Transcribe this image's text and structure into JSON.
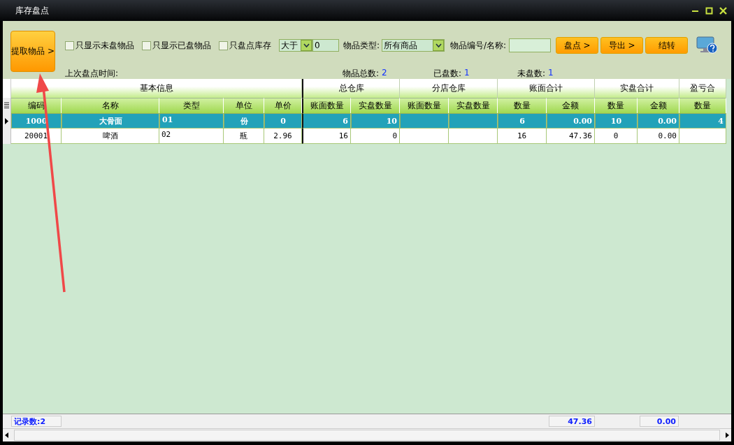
{
  "window": {
    "title": "库存盘点"
  },
  "toolbar": {
    "extract_button": "提取物品 >",
    "checkboxes": [
      {
        "label": "只显示未盘物品",
        "checked": false
      },
      {
        "label": "只显示已盘物品",
        "checked": false
      },
      {
        "label": "只盘点库存",
        "checked": false
      }
    ],
    "compare_select": "大于",
    "compare_value": "0",
    "type_label": "物品类型:",
    "type_select": "所有商品",
    "search_label": "物品编号/名称:",
    "buttons": [
      "盘点 >",
      "导出 >",
      "结转"
    ],
    "last_count_label": "上次盘点时间:",
    "stats": [
      {
        "label": "物品总数:",
        "value": "2"
      },
      {
        "label": "已盘数:",
        "value": "1"
      },
      {
        "label": "未盘数:",
        "value": "1"
      }
    ]
  },
  "table": {
    "groups": [
      {
        "label": "基本信息",
        "columns": [
          "编码",
          "名称",
          "类型",
          "单位",
          "单价"
        ]
      },
      {
        "label": "总仓库",
        "columns": [
          "账面数量",
          "实盘数量"
        ]
      },
      {
        "label": "分店仓库",
        "columns": [
          "账面数量",
          "实盘数量"
        ]
      },
      {
        "label": "账面合计",
        "columns": [
          "数量",
          "金额"
        ]
      },
      {
        "label": "实盘合计",
        "columns": [
          "数量",
          "金额"
        ]
      },
      {
        "label": "盈亏合",
        "columns": [
          "数量"
        ]
      }
    ],
    "rows": [
      {
        "selected": true,
        "cells": [
          "1000",
          "大骨面",
          "01",
          "份",
          "0",
          "6",
          "10",
          null,
          null,
          "6",
          "0.00",
          "10",
          "0.00",
          "4"
        ]
      },
      {
        "selected": false,
        "cells": [
          "20001",
          "啤酒",
          "02",
          "瓶",
          "2.96",
          "16",
          "0",
          null,
          null,
          "16",
          "47.36",
          "0",
          "0.00",
          null
        ]
      }
    ]
  },
  "footer": {
    "record_count": "记录数:2",
    "book_amount_total": "47.36",
    "actual_amount_total": "0.00"
  }
}
